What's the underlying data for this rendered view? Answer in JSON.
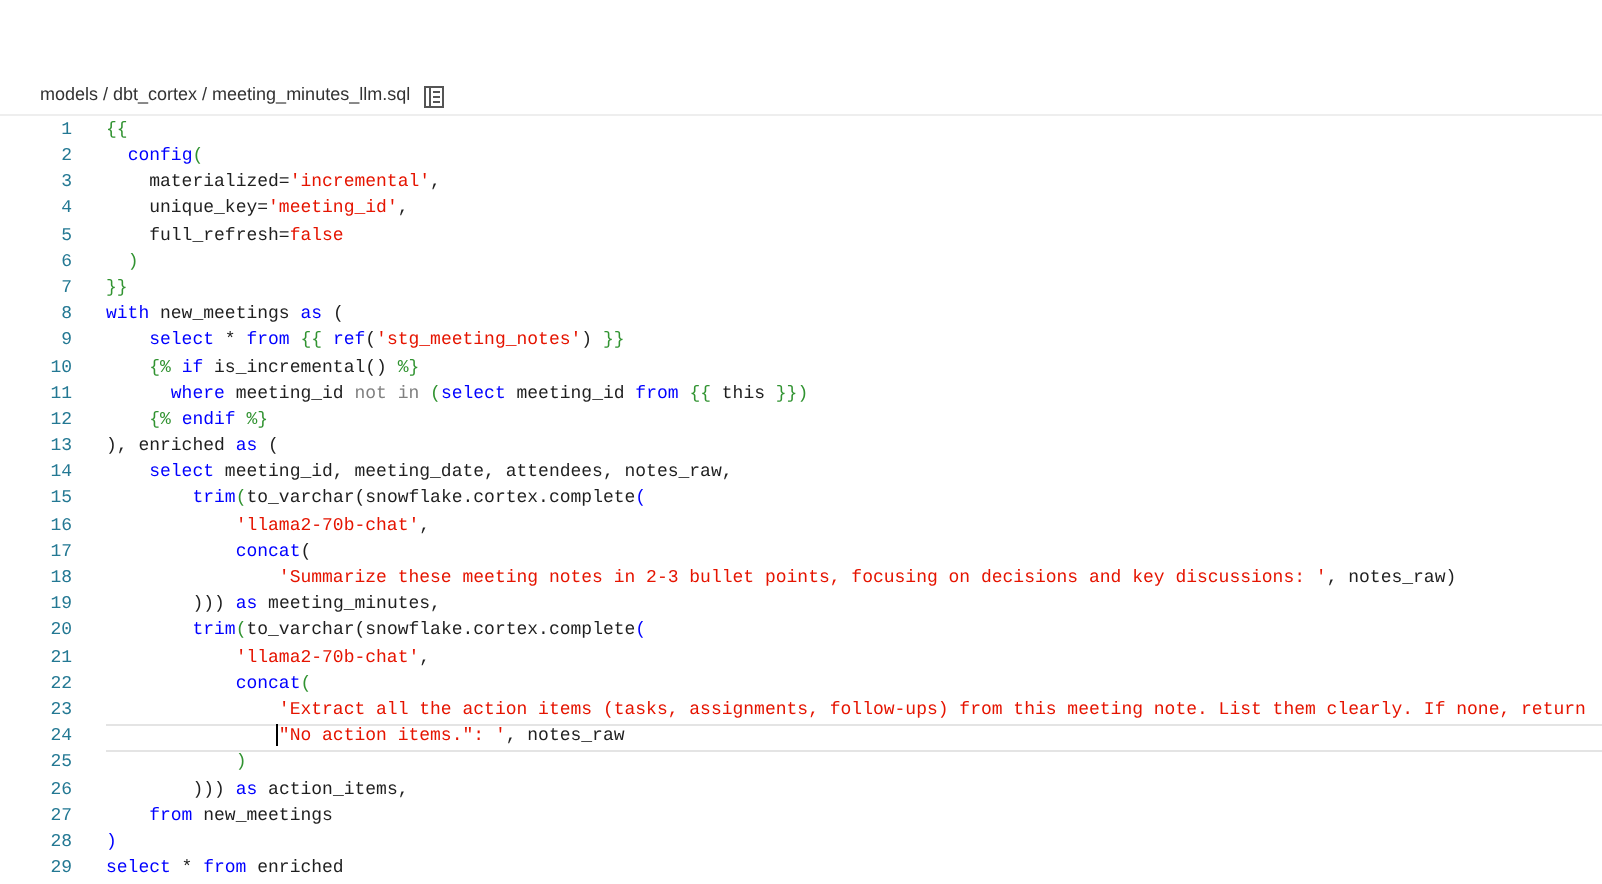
{
  "breadcrumb": {
    "path": "models / dbt_cortex / meeting_minutes_llm.sql"
  },
  "editor": {
    "lines": [
      {
        "number": "1",
        "current": false,
        "tokens": [
          {
            "text": "{{",
            "kind": "brace"
          }
        ]
      },
      {
        "number": "2",
        "current": false,
        "tokens": [
          {
            "text": "  config",
            "kind": "keyword"
          },
          {
            "text": "(",
            "kind": "brace"
          }
        ]
      },
      {
        "number": "3",
        "current": false,
        "tokens": [
          {
            "text": "    materialized=",
            "kind": "plain"
          },
          {
            "text": "'incremental'",
            "kind": "string"
          },
          {
            "text": ",",
            "kind": "plain"
          }
        ]
      },
      {
        "number": "4",
        "current": false,
        "tokens": [
          {
            "text": "    unique_key=",
            "kind": "plain"
          },
          {
            "text": "'meeting_id'",
            "kind": "string"
          },
          {
            "text": ",",
            "kind": "plain"
          }
        ]
      },
      {
        "number": "5",
        "current": false,
        "tokens": [
          {
            "text": "    full_refresh=",
            "kind": "plain"
          },
          {
            "text": "false",
            "kind": "string"
          }
        ]
      },
      {
        "number": "6",
        "current": false,
        "tokens": [
          {
            "text": "  )",
            "kind": "brace"
          }
        ]
      },
      {
        "number": "7",
        "current": false,
        "tokens": [
          {
            "text": "}}",
            "kind": "brace"
          }
        ]
      },
      {
        "number": "8",
        "current": false,
        "tokens": [
          {
            "text": "with",
            "kind": "keyword"
          },
          {
            "text": " new_meetings ",
            "kind": "plain"
          },
          {
            "text": "as",
            "kind": "keyword"
          },
          {
            "text": " (",
            "kind": "plain"
          }
        ]
      },
      {
        "number": "9",
        "current": false,
        "tokens": [
          {
            "text": "    select",
            "kind": "keyword"
          },
          {
            "text": " * ",
            "kind": "plain"
          },
          {
            "text": "from ",
            "kind": "keyword"
          },
          {
            "text": "{{ ",
            "kind": "brace"
          },
          {
            "text": "ref",
            "kind": "keyword"
          },
          {
            "text": "(",
            "kind": "plain"
          },
          {
            "text": "'stg_meeting_notes'",
            "kind": "string"
          },
          {
            "text": ") ",
            "kind": "plain"
          },
          {
            "text": "}}",
            "kind": "brace"
          }
        ]
      },
      {
        "number": "10",
        "current": false,
        "tokens": [
          {
            "text": "    {% ",
            "kind": "brace"
          },
          {
            "text": "if",
            "kind": "keyword"
          },
          {
            "text": " is_incremental() ",
            "kind": "plain"
          },
          {
            "text": "%}",
            "kind": "brace"
          }
        ]
      },
      {
        "number": "11",
        "current": false,
        "tokens": [
          {
            "text": "      where",
            "kind": "keyword"
          },
          {
            "text": " meeting_id ",
            "kind": "plain"
          },
          {
            "text": "not in ",
            "kind": "operator"
          },
          {
            "text": "(",
            "kind": "brace"
          },
          {
            "text": "select",
            "kind": "keyword"
          },
          {
            "text": " meeting_id ",
            "kind": "plain"
          },
          {
            "text": "from ",
            "kind": "keyword"
          },
          {
            "text": "{{",
            "kind": "brace"
          },
          {
            "text": " this ",
            "kind": "plain"
          },
          {
            "text": "}})",
            "kind": "brace"
          }
        ]
      },
      {
        "number": "12",
        "current": false,
        "tokens": [
          {
            "text": "    {% ",
            "kind": "brace"
          },
          {
            "text": "endif ",
            "kind": "keyword"
          },
          {
            "text": "%}",
            "kind": "brace"
          }
        ]
      },
      {
        "number": "13",
        "current": false,
        "tokens": [
          {
            "text": "), enriched ",
            "kind": "plain"
          },
          {
            "text": "as",
            "kind": "keyword"
          },
          {
            "text": " (",
            "kind": "plain"
          }
        ]
      },
      {
        "number": "14",
        "current": false,
        "tokens": [
          {
            "text": "    select",
            "kind": "keyword"
          },
          {
            "text": " meeting_id, meeting_date, attendees, notes_raw,",
            "kind": "plain"
          }
        ]
      },
      {
        "number": "15",
        "current": false,
        "tokens": [
          {
            "text": "        trim",
            "kind": "keyword"
          },
          {
            "text": "(",
            "kind": "brace"
          },
          {
            "text": "to_varchar(snowflake.cortex.complete",
            "kind": "plain"
          },
          {
            "text": "(",
            "kind": "keyword"
          }
        ]
      },
      {
        "number": "16",
        "current": false,
        "tokens": [
          {
            "text": "            'llama2-70b-chat'",
            "kind": "string"
          },
          {
            "text": ",",
            "kind": "plain"
          }
        ]
      },
      {
        "number": "17",
        "current": false,
        "tokens": [
          {
            "text": "            concat",
            "kind": "keyword"
          },
          {
            "text": "(",
            "kind": "plain"
          }
        ]
      },
      {
        "number": "18",
        "current": false,
        "tokens": [
          {
            "text": "                'Summarize these meeting notes in 2-3 bullet points, focusing on decisions and key discussions: '",
            "kind": "string"
          },
          {
            "text": ", notes_raw)",
            "kind": "plain"
          }
        ]
      },
      {
        "number": "19",
        "current": false,
        "tokens": [
          {
            "text": "        ))) ",
            "kind": "plain"
          },
          {
            "text": "as",
            "kind": "keyword"
          },
          {
            "text": " meeting_minutes,",
            "kind": "plain"
          }
        ]
      },
      {
        "number": "20",
        "current": false,
        "tokens": [
          {
            "text": "        trim",
            "kind": "keyword"
          },
          {
            "text": "(",
            "kind": "brace"
          },
          {
            "text": "to_varchar(snowflake.cortex.complete",
            "kind": "plain"
          },
          {
            "text": "(",
            "kind": "keyword"
          }
        ]
      },
      {
        "number": "21",
        "current": false,
        "tokens": [
          {
            "text": "            'llama2-70b-chat'",
            "kind": "string"
          },
          {
            "text": ",",
            "kind": "plain"
          }
        ]
      },
      {
        "number": "22",
        "current": false,
        "tokens": [
          {
            "text": "            concat",
            "kind": "keyword"
          },
          {
            "text": "(",
            "kind": "brace"
          }
        ]
      },
      {
        "number": "23",
        "current": false,
        "tokens": [
          {
            "text": "                'Extract all the action items (tasks, assignments, follow-ups) from this meeting note. List them clearly. If none, return",
            "kind": "string"
          }
        ]
      },
      {
        "number": "24",
        "current": true,
        "tokens": [
          {
            "text": "                \"No action items.\": '",
            "kind": "string"
          },
          {
            "text": ", notes_raw",
            "kind": "plain"
          }
        ]
      },
      {
        "number": "25",
        "current": false,
        "tokens": [
          {
            "text": "            )",
            "kind": "brace"
          }
        ]
      },
      {
        "number": "26",
        "current": false,
        "tokens": [
          {
            "text": "        ))) ",
            "kind": "plain"
          },
          {
            "text": "as",
            "kind": "keyword"
          },
          {
            "text": " action_items,",
            "kind": "plain"
          }
        ]
      },
      {
        "number": "27",
        "current": false,
        "tokens": [
          {
            "text": "    from",
            "kind": "keyword"
          },
          {
            "text": " new_meetings",
            "kind": "plain"
          }
        ]
      },
      {
        "number": "28",
        "current": false,
        "tokens": [
          {
            "text": ")",
            "kind": "keyword"
          }
        ]
      },
      {
        "number": "29",
        "current": false,
        "tokens": [
          {
            "text": "select",
            "kind": "keyword"
          },
          {
            "text": " * ",
            "kind": "plain"
          },
          {
            "text": "from",
            "kind": "keyword"
          },
          {
            "text": " enriched",
            "kind": "plain"
          }
        ]
      }
    ]
  }
}
